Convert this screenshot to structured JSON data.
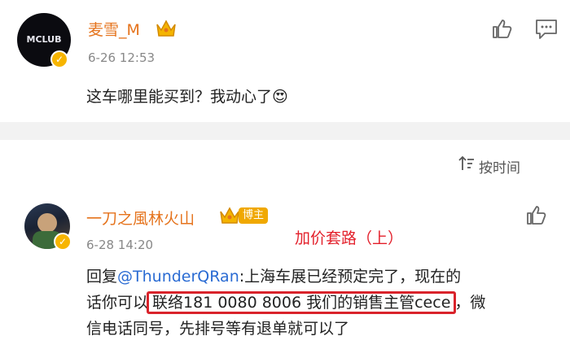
{
  "comments": [
    {
      "user": "麦雪_M",
      "avatar_text": "MCLUB",
      "time": "6-26 12:53",
      "text": "这车哪里能买到？我动心了",
      "emoji": "😍"
    },
    {
      "user": "一刀之風林火山",
      "badge": "博主",
      "time": "6-28 14:20",
      "text_prefix": "回复",
      "mention": "@ThunderQRan",
      "text_line1_rest": ":上海车展已经预定完了，现在的",
      "text_line2_pre": "话你可以",
      "highlighted": "联络181 0080 8006 我们的销售主管cece",
      "text_line2_post": "，微",
      "text_line3": "信电话同号，先排号等有退单就可以了"
    }
  ],
  "sort": {
    "label": "按时间",
    "icon": "sort-icon"
  },
  "annotation": "加价套路（上）",
  "icons": {
    "like": "thumbs-up-icon",
    "comment": "comment-icon",
    "crown": "crown-icon",
    "verified": "verified-icon"
  },
  "colors": {
    "username": "#e5731c",
    "mention": "#2a6bd3",
    "annotation": "#e3202b",
    "highlight_box": "#d9232b"
  }
}
